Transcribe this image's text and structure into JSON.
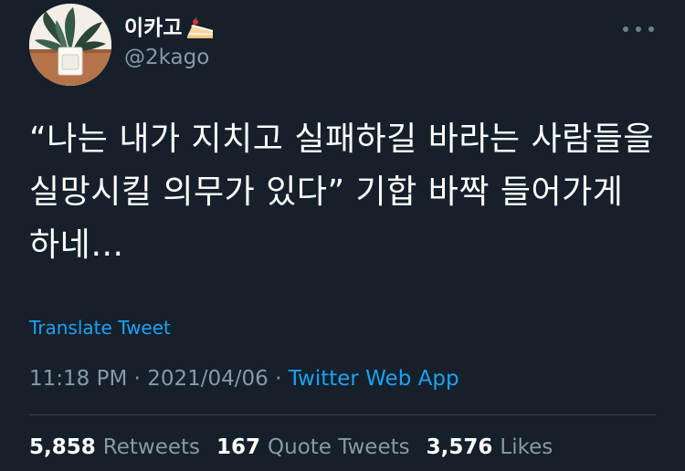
{
  "author": {
    "display_name": "이카고",
    "name_emoji": "cake-icon",
    "handle": "@2kago",
    "avatar": "potted-plant-avatar"
  },
  "tweet": {
    "text": "“나는 내가 지치고 실패하길 바라는 사람들을\n실망시킬 의무가 있다” 기합 바짝 들어가게\n하네…",
    "translate_label": "Translate Tweet",
    "time": "11:18 PM",
    "date": "2021/04/06",
    "separator": "·",
    "source": "Twitter Web App"
  },
  "stats": {
    "retweets_count": "5,858",
    "retweets_label": "Retweets",
    "quotes_count": "167",
    "quotes_label": "Quote Tweets",
    "likes_count": "3,576",
    "likes_label": "Likes"
  },
  "colors": {
    "background": "#15202b",
    "text": "#ffffff",
    "secondary": "#8899a6",
    "link": "#1da1f2",
    "divider": "#38444d"
  }
}
